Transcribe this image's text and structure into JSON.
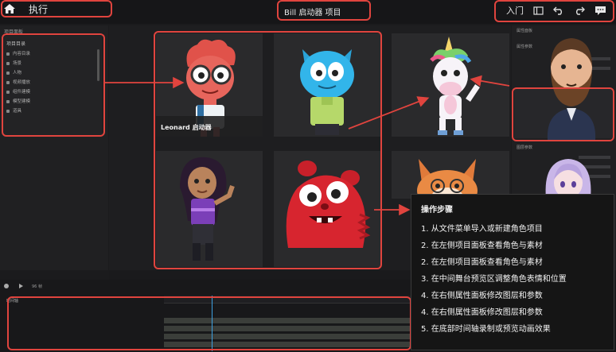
{
  "topbar": {
    "menu_run": "执行",
    "project_title": "Bill 启动器 项目",
    "right_label": "入门",
    "icons": [
      "home-icon",
      "panel-icon",
      "undo-icon",
      "redo-icon",
      "comment-icon"
    ]
  },
  "left_panel": {
    "title": "项目面板",
    "project_header": "项目目录",
    "tree_items": [
      "内容目录",
      "场景",
      "人物",
      "视频播放",
      "组件建模",
      "模型建模",
      "道具"
    ]
  },
  "stage": {
    "tiles": [
      {
        "character": "red-shaggy-character",
        "label": "Leonard 启动器"
      },
      {
        "character": "blue-cat-character",
        "label": ""
      },
      {
        "character": "unicorn-character",
        "label": ""
      },
      {
        "character": "girl-character",
        "label": ""
      },
      {
        "character": "red-monster-character",
        "label": ""
      },
      {
        "character": "fox-character",
        "label": ""
      }
    ]
  },
  "right_panel": {
    "title_1": "属性面板",
    "title_2": "属性参数",
    "title_3": "图层参数",
    "characters": [
      "bearded-man-character",
      "anime-girl-character"
    ]
  },
  "steps": {
    "title": "操作步骤",
    "items": [
      "1. 从文件菜单导入或新建角色项目",
      "2. 在左侧项目面板查看角色与素材",
      "2. 在左侧项目面板查看角色与素材",
      "3. 在中间舞台预览区调整角色表情和位置",
      "4. 在右侧属性面板修改图层和参数",
      "4. 在右侧属性面板修改图层和参数",
      "5. 在底部时间轴录制或预览动画效果"
    ]
  },
  "timeline": {
    "tab_label": "时间轴",
    "toolbar_label": "96 帧"
  },
  "colors": {
    "highlight": "#e0443e",
    "background": "#1b1b1d",
    "playhead": "#3ca0e0"
  }
}
